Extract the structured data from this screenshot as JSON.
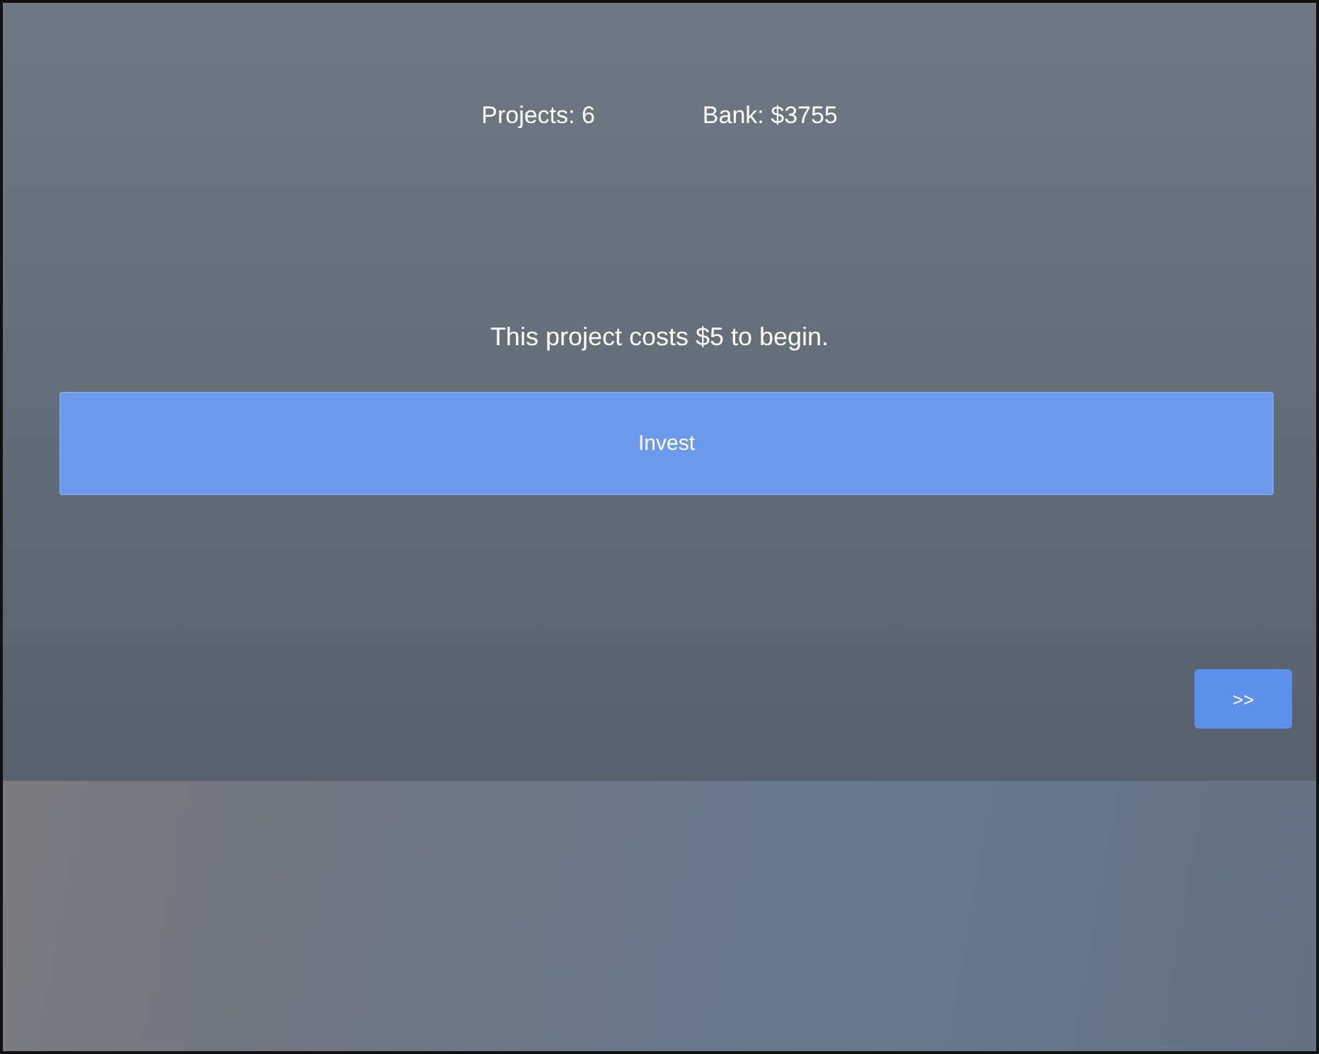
{
  "stats": [
    "Projects: 6",
    "Bank: $3755"
  ],
  "message": "This project costs $5 to begin.",
  "invest_button": "Invest",
  "next_button": ">>"
}
